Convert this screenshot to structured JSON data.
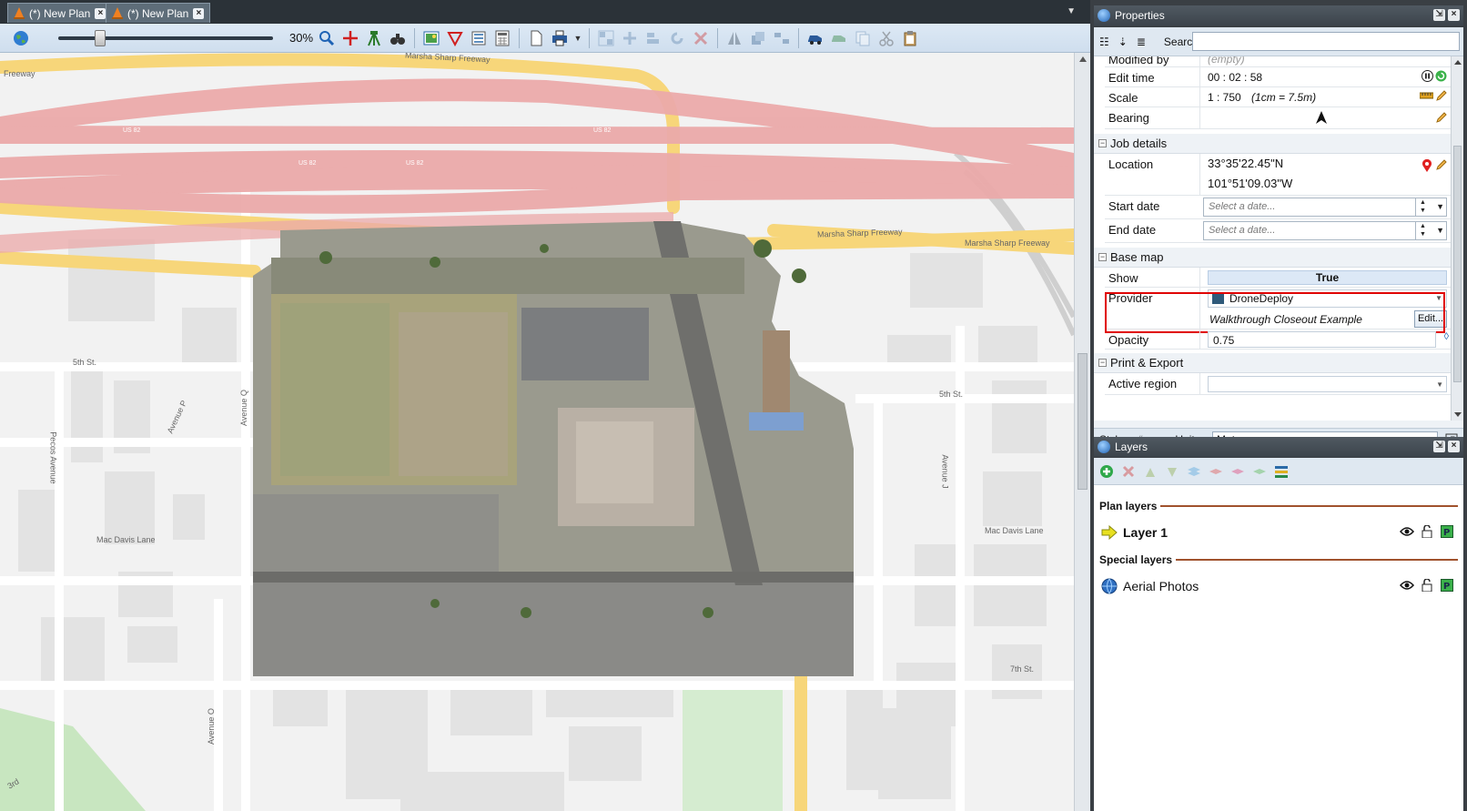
{
  "document_tabs": [
    {
      "label": "(*) New Plan"
    },
    {
      "label": "(*) New Plan"
    }
  ],
  "toolbar": {
    "zoom_percent": "30%",
    "zoom_level": 0.18
  },
  "map": {
    "labels": {
      "freeway_top": "Marsha Sharp Freeway",
      "freeway_left": "Freeway",
      "freeway_right1": "Marsha Sharp Freeway",
      "freeway_right2": "Marsha Sharp Freeway",
      "us82_1": "US 82",
      "us82_2": "US 82",
      "us82_3": "US 82",
      "us82_4": "US 82",
      "fifth_st_left": "5th St.",
      "fifth_st_right": "5th St.",
      "avenue_p": "Avenue P",
      "avenue_q": "Avenue Q",
      "avenue_o": "Avenue O",
      "avenue_j": "Avenue J",
      "pecos_avenue": "Pecos Avenue",
      "mac_davis_left": "Mac Davis Lane",
      "mac_davis_right": "Mac Davis Lane",
      "seventh_st": "7th St.",
      "third": "3rd"
    }
  },
  "properties": {
    "title": "Properties",
    "search_label": "Search:",
    "search_value": "",
    "rows": {
      "modified_by": {
        "name": "Modified by",
        "value": "(empty)"
      },
      "edit_time": {
        "name": "Edit time",
        "value": "00 : 02 : 58"
      },
      "scale": {
        "name": "Scale",
        "value": "1 : 750",
        "note": "(1cm = 7.5m)"
      },
      "bearing": {
        "name": "Bearing"
      }
    },
    "categories": {
      "job_details": "Job details",
      "base_map": "Base map",
      "print_export": "Print & Export"
    },
    "job_details": {
      "location_name": "Location",
      "latitude": "33°35'22.45\"N",
      "longitude": "101°51'09.03\"W",
      "start_date_name": "Start date",
      "start_date_placeholder": "Select a date...",
      "end_date_name": "End date",
      "end_date_placeholder": "Select a date..."
    },
    "base_map": {
      "show_name": "Show",
      "show_value": "True",
      "provider_name": "Provider",
      "provider_value": "DroneDeploy",
      "provider_sub": "Walkthrough Closeout Example",
      "edit_button": "Edit...",
      "opacity_name": "Opacity",
      "opacity_value": "0.75"
    },
    "print_export": {
      "active_region_name": "Active region",
      "active_region_value": ""
    },
    "footer": {
      "styles_label": "Styles:",
      "units_label": "Units:",
      "units_value": "Meters"
    }
  },
  "layers": {
    "title": "Layers",
    "plan_layers_heading": "Plan layers",
    "special_layers_heading": "Special layers",
    "items": [
      {
        "label": "Layer 1"
      },
      {
        "label": "Aerial Photos"
      }
    ]
  },
  "colors": {
    "highlight_box": "#e00000",
    "freeway_fill": "#e9a3a3",
    "arterial_fill": "#f6d77c",
    "panel_title": "#454e57"
  }
}
